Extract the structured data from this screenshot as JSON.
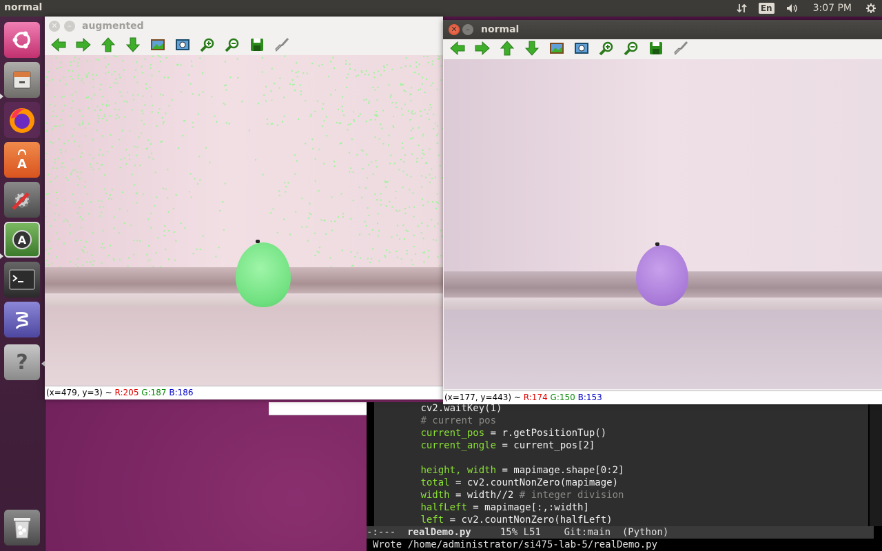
{
  "topbar": {
    "app_title": "normal",
    "keyboard": "En",
    "clock": "3:07 PM",
    "icons": [
      "network-arrows-icon",
      "keyboard-layout-icon",
      "volume-icon",
      "power-gear-icon"
    ]
  },
  "launcher": {
    "items": [
      {
        "name": "ubuntu-dash",
        "icon": "ubuntu-logo-icon",
        "color": "#e05a9a"
      },
      {
        "name": "files",
        "icon": "file-cabinet-icon",
        "color": "#8b8b8b"
      },
      {
        "name": "firefox",
        "icon": "firefox-icon",
        "color": "#e66000"
      },
      {
        "name": "software-center",
        "icon": "shopping-bag-icon",
        "color": "#e5672a"
      },
      {
        "name": "system-settings",
        "icon": "gear-wrench-icon",
        "color": "#666"
      },
      {
        "name": "software-updater",
        "icon": "updater-icon",
        "color": "#4a8a3a"
      },
      {
        "name": "terminal",
        "icon": "terminal-icon",
        "color": "#2c2c2c"
      },
      {
        "name": "emacs",
        "icon": "emacs-icon",
        "color": "#5c56a8"
      },
      {
        "name": "help",
        "icon": "question-icon",
        "color": "#9a9a9a"
      },
      {
        "name": "trash",
        "icon": "trash-icon",
        "color": "#6a6a6a"
      }
    ]
  },
  "windows": {
    "augmented": {
      "title": "augmented",
      "status": {
        "coords": "(x=479, y=3) ~ ",
        "r": "R:205",
        "g": "G:187",
        "b": "B:186"
      }
    },
    "normal": {
      "title": "normal",
      "status": {
        "coords": "(x=177, y=443) ~ ",
        "r": "R:174",
        "g": "G:150",
        "b": "B:153"
      }
    }
  },
  "toolbar_icons": [
    "pan-left-icon",
    "pan-right-icon",
    "pan-up-icon",
    "pan-down-icon",
    "zoom-fit-icon",
    "zoom-region-icon",
    "zoom-in-icon",
    "zoom-out-icon",
    "save-icon",
    "properties-brush-icon"
  ],
  "emacs": {
    "lines": [
      {
        "indent": "        ",
        "parts": [
          {
            "t": "cv2.waitKey(1)",
            "c": "code"
          }
        ]
      },
      {
        "indent": "        ",
        "parts": [
          {
            "t": "# current pos",
            "c": "cm"
          }
        ]
      },
      {
        "indent": "        ",
        "parts": [
          {
            "t": "current_pos",
            "c": "kw"
          },
          {
            "t": " = r.getPositionTup()",
            "c": "code"
          }
        ]
      },
      {
        "indent": "        ",
        "parts": [
          {
            "t": "current_angle",
            "c": "kw"
          },
          {
            "t": " = current_pos[2]",
            "c": "code"
          }
        ]
      },
      {
        "indent": "",
        "parts": []
      },
      {
        "indent": "        ",
        "parts": [
          {
            "t": "height, width",
            "c": "kw"
          },
          {
            "t": " = mapimage.shape[0:2]",
            "c": "code"
          }
        ]
      },
      {
        "indent": "        ",
        "parts": [
          {
            "t": "total",
            "c": "kw"
          },
          {
            "t": " = cv2.countNonZero(mapimage)",
            "c": "code"
          }
        ]
      },
      {
        "indent": "        ",
        "parts": [
          {
            "t": "width",
            "c": "kw"
          },
          {
            "t": " = width//2 ",
            "c": "code"
          },
          {
            "t": "# integer division",
            "c": "cm"
          }
        ]
      },
      {
        "indent": "        ",
        "parts": [
          {
            "t": "halfLeft",
            "c": "kw"
          },
          {
            "t": " = mapimage[:,:width]",
            "c": "code"
          }
        ]
      },
      {
        "indent": "        ",
        "parts": [
          {
            "t": "left",
            "c": "kw"
          },
          {
            "t": " = cv2.countNonZero(halfLeft)",
            "c": "code"
          }
        ]
      }
    ],
    "modeline": {
      "state": "-:---  ",
      "file": "realDemo.py",
      "rest": "     15% L51    Git:main  (Python)"
    },
    "minibuffer": "Wrote /home/administrator/si475-lab-5/realDemo.py"
  }
}
